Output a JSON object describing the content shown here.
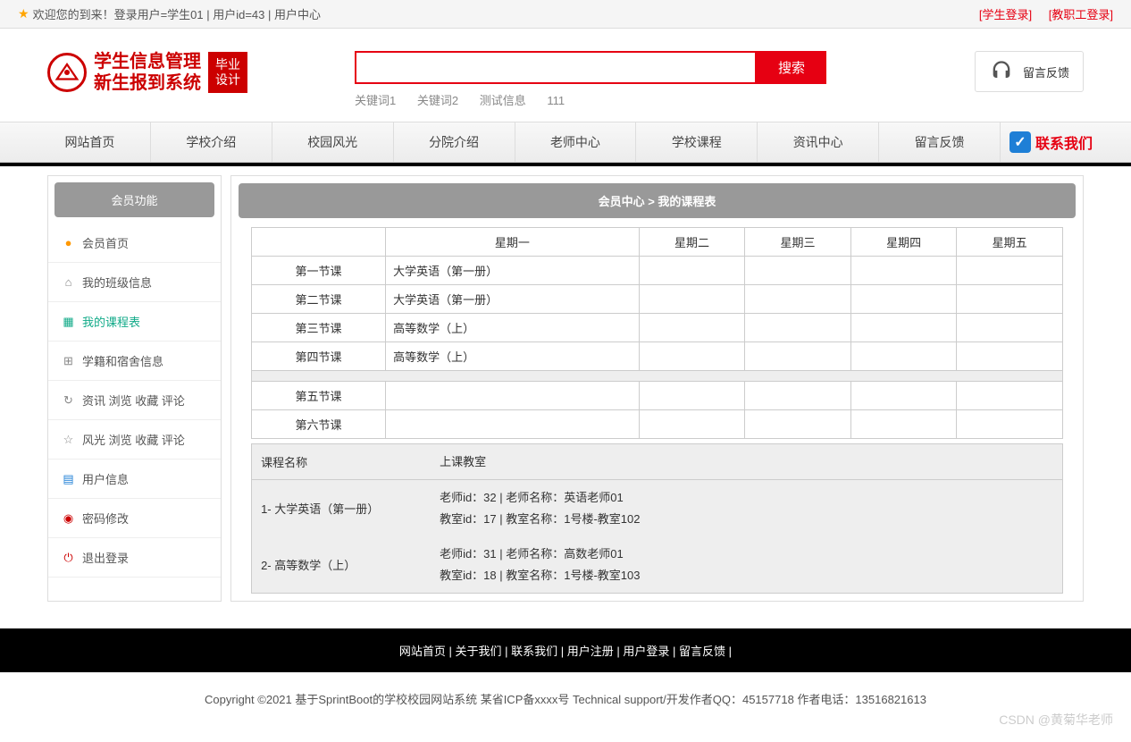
{
  "topbar": {
    "welcome": "欢迎您的到来！登录用户=学生01 | 用户id=43 | 用户中心",
    "student_login": "[学生登录]",
    "staff_login": "[教职工登录]"
  },
  "logo": {
    "line1": "学生信息管理",
    "line2": "新生报到系统",
    "badge_line1": "毕业",
    "badge_line2": "设计"
  },
  "search": {
    "button": "搜索",
    "kw1": "关键词1",
    "kw2": "关键词2",
    "kw3": "测试信息",
    "kw4": "111"
  },
  "feedback_label": "留言反馈",
  "nav": {
    "items": [
      "网站首页",
      "学校介绍",
      "校园风光",
      "分院介绍",
      "老师中心",
      "学校课程",
      "资讯中心",
      "留言反馈"
    ],
    "contact": "联系我们"
  },
  "sidebar": {
    "title": "会员功能",
    "items": [
      {
        "label": "会员首页",
        "icon": "●",
        "color": "#ff9800"
      },
      {
        "label": "我的班级信息",
        "icon": "⌂",
        "color": "#888"
      },
      {
        "label": "我的课程表",
        "icon": "▦",
        "color": "#1a8"
      },
      {
        "label": "学籍和宿舍信息",
        "icon": "⊞",
        "color": "#888"
      },
      {
        "label": "资讯 浏览 收藏 评论",
        "icon": "↻",
        "color": "#888"
      },
      {
        "label": "风光 浏览 收藏 评论",
        "icon": "☆",
        "color": "#888"
      },
      {
        "label": "用户信息",
        "icon": "▤",
        "color": "#1e7fd6"
      },
      {
        "label": "密码修改",
        "icon": "◉",
        "color": "#c00"
      },
      {
        "label": "退出登录",
        "icon": "⏻",
        "color": "#c00"
      }
    ]
  },
  "breadcrumb": "会员中心 > 我的课程表",
  "schedule": {
    "headers": [
      "",
      "星期一",
      "星期二",
      "星期三",
      "星期四",
      "星期五"
    ],
    "rows": [
      {
        "period": "第一节课",
        "mon": "大学英语（第一册）"
      },
      {
        "period": "第二节课",
        "mon": "大学英语（第一册）"
      },
      {
        "period": "第三节课",
        "mon": "高等数学（上）"
      },
      {
        "period": "第四节课",
        "mon": "高等数学（上）"
      }
    ],
    "rows2": [
      {
        "period": "第五节课"
      },
      {
        "period": "第六节课"
      }
    ]
  },
  "course_info": {
    "h1": "课程名称",
    "h2": "上课教室",
    "courses": [
      {
        "name": "1- 大学英语（第一册）",
        "line1": "老师id：32 | 老师名称：英语老师01",
        "line2": "教室id：17 | 教室名称：1号楼-教室102"
      },
      {
        "name": "2- 高等数学（上）",
        "line1": "老师id：31 | 老师名称：高数老师01",
        "line2": "教室id：18 | 教室名称：1号楼-教室103"
      }
    ]
  },
  "footer": {
    "links": [
      "网站首页",
      "关于我们",
      "联系我们",
      "用户注册",
      "用户登录",
      "留言反馈"
    ],
    "sep": "   |   ",
    "copy": "Copyright ©2021 基于SprintBoot的学校校园网站系统    某省ICP备xxxx号    Technical support/开发作者QQ：45157718    作者电话：13516821613"
  },
  "watermark": "CSDN @黄菊华老师"
}
